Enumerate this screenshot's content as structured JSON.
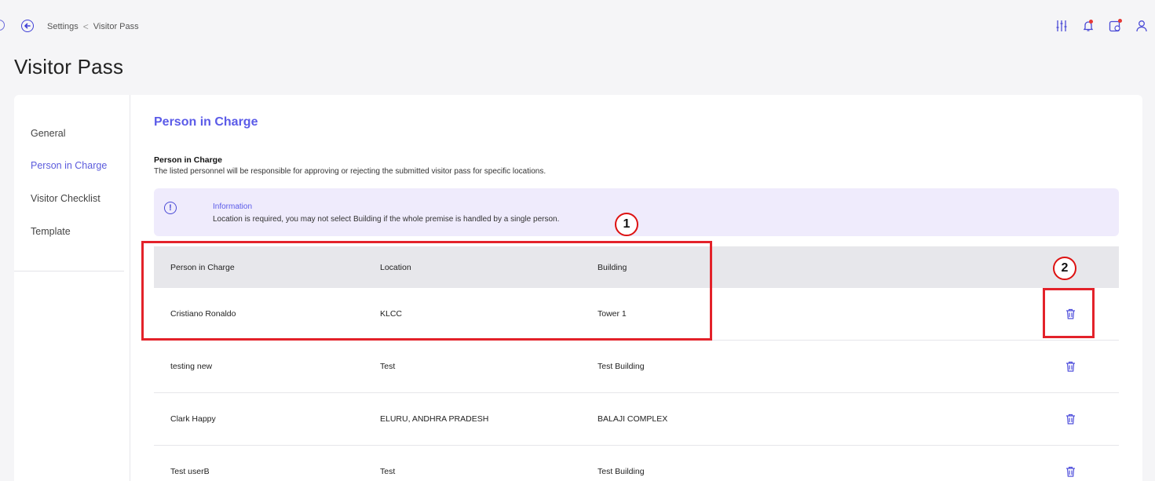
{
  "breadcrumb": {
    "parent": "Settings",
    "separator": "<",
    "current": "Visitor Pass"
  },
  "page": {
    "title": "Visitor Pass"
  },
  "sidebar": {
    "items": [
      {
        "label": "General"
      },
      {
        "label": "Person in Charge"
      },
      {
        "label": "Visitor Checklist"
      },
      {
        "label": "Template"
      }
    ]
  },
  "section": {
    "title": "Person in Charge",
    "subtitle": "Person in Charge",
    "description": "The listed personnel will be responsible for approving or rejecting the submitted visitor pass for specific locations."
  },
  "info": {
    "icon": "exclamation-circle-icon",
    "heading": "Information",
    "text": "Location is required, you may not select Building if the whole premise is handled by a single person."
  },
  "table": {
    "headers": [
      "Person in Charge",
      "Location",
      "Building"
    ],
    "rows": [
      {
        "person": "Cristiano Ronaldo",
        "location": "KLCC",
        "building": "Tower 1"
      },
      {
        "person": "testing new",
        "location": "Test",
        "building": "Test Building"
      },
      {
        "person": "Clark Happy",
        "location": "ELURU, ANDHRA PRADESH",
        "building": "BALAJI COMPLEX"
      },
      {
        "person": "Test userB",
        "location": "Test",
        "building": "Test Building"
      }
    ]
  },
  "annotations": {
    "one": "1",
    "two": "2"
  },
  "colors": {
    "accent": "#5b5be8",
    "annotation": "#e3222a",
    "info_bg": "#efebfc"
  }
}
